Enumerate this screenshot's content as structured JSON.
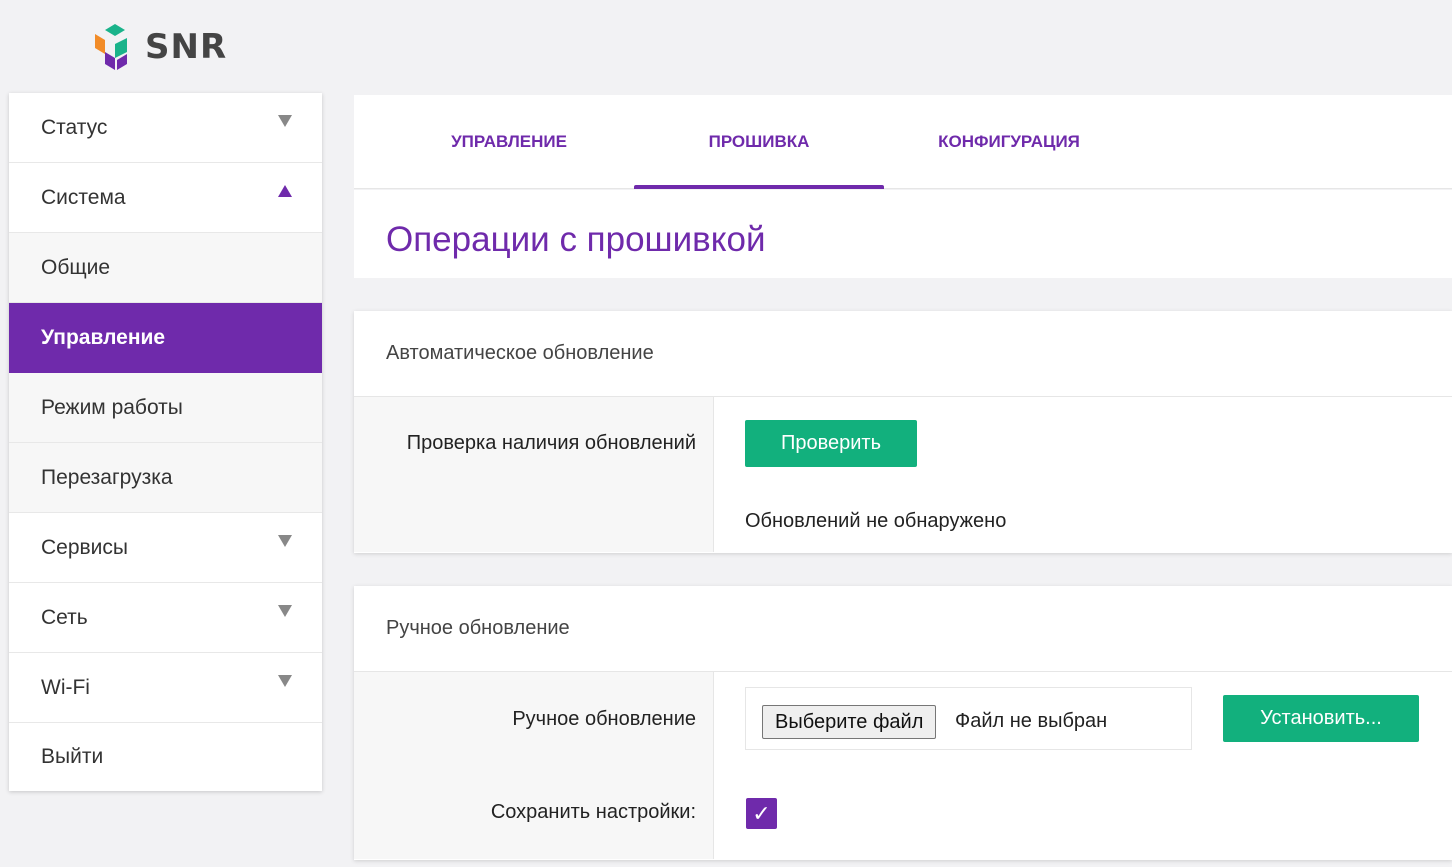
{
  "logo": {
    "text": "SNR"
  },
  "sidebar": {
    "items": [
      {
        "label": "Статус",
        "arrow": "down"
      },
      {
        "label": "Система",
        "arrow": "up"
      },
      {
        "label": "Общие",
        "sub": true
      },
      {
        "label": "Управление",
        "sub": true,
        "active": true
      },
      {
        "label": "Режим работы",
        "sub": true
      },
      {
        "label": "Перезагрузка",
        "sub": true
      },
      {
        "label": "Сервисы",
        "arrow": "down"
      },
      {
        "label": "Сеть",
        "arrow": "down"
      },
      {
        "label": "Wi-Fi",
        "arrow": "down"
      },
      {
        "label": "Выйти"
      }
    ]
  },
  "tabs": [
    {
      "label": "УПРАВЛЕНИЕ"
    },
    {
      "label": "ПРОШИВКА",
      "active": true
    },
    {
      "label": "КОНФИГУРАЦИЯ"
    }
  ],
  "page": {
    "title": "Операции с прошивкой"
  },
  "auto_update": {
    "header": "Автоматическое обновление",
    "check_label": "Проверка наличия обновлений",
    "check_button": "Проверить",
    "status": "Обновлений не обнаружено"
  },
  "manual_update": {
    "header": "Ручное обновление",
    "file_label": "Ручное обновление",
    "choose_file_button": "Выберите файл",
    "file_status": "Файл не выбран",
    "install_button": "Установить...",
    "keep_settings_label": "Сохранить настройки:",
    "keep_settings_checked": true,
    "checkmark": "✓"
  },
  "colors": {
    "accent": "#6f2aab",
    "button_green": "#12b07d",
    "background": "#f2f2f4"
  }
}
